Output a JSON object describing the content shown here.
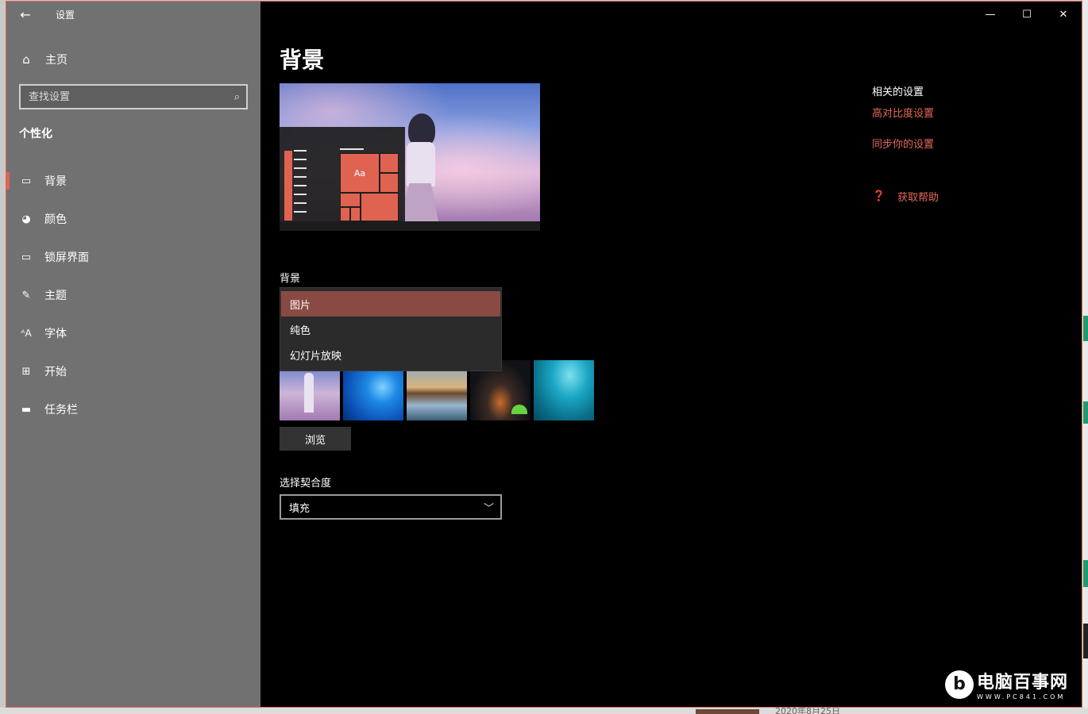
{
  "window": {
    "title": "设置"
  },
  "sidebar": {
    "home_label": "主页",
    "search_placeholder": "查找设置",
    "section_title": "个性化",
    "items": [
      {
        "label": "背景",
        "icon": "picture-icon"
      },
      {
        "label": "颜色",
        "icon": "palette-icon"
      },
      {
        "label": "锁屏界面",
        "icon": "lock-screen-icon"
      },
      {
        "label": "主题",
        "icon": "theme-icon"
      },
      {
        "label": "字体",
        "icon": "font-icon"
      },
      {
        "label": "开始",
        "icon": "start-icon"
      },
      {
        "label": "任务栏",
        "icon": "taskbar-icon"
      }
    ],
    "active_index": 0
  },
  "main": {
    "title": "背景",
    "preview": {
      "tile_text": "Aa"
    },
    "background_label": "背景",
    "background_options": [
      "图片",
      "纯色",
      "幻灯片放映"
    ],
    "background_selected": "图片",
    "browse_label": "浏览",
    "fit_label": "选择契合度",
    "fit_value": "填充"
  },
  "related": {
    "title": "相关的设置",
    "links": [
      "高对比度设置",
      "同步你的设置"
    ],
    "help_label": "获取帮助"
  },
  "desktop": {
    "date_text": "2020年8月25日"
  },
  "watermark": {
    "logo": "b",
    "name": "电脑百事网",
    "url": "WWW.PC841.COM"
  },
  "colors": {
    "accent": "#e06352",
    "link": "#e56a58",
    "sidebar_bg": "#717171",
    "content_bg": "#000000",
    "selected_option_bg": "#8a4a44"
  }
}
